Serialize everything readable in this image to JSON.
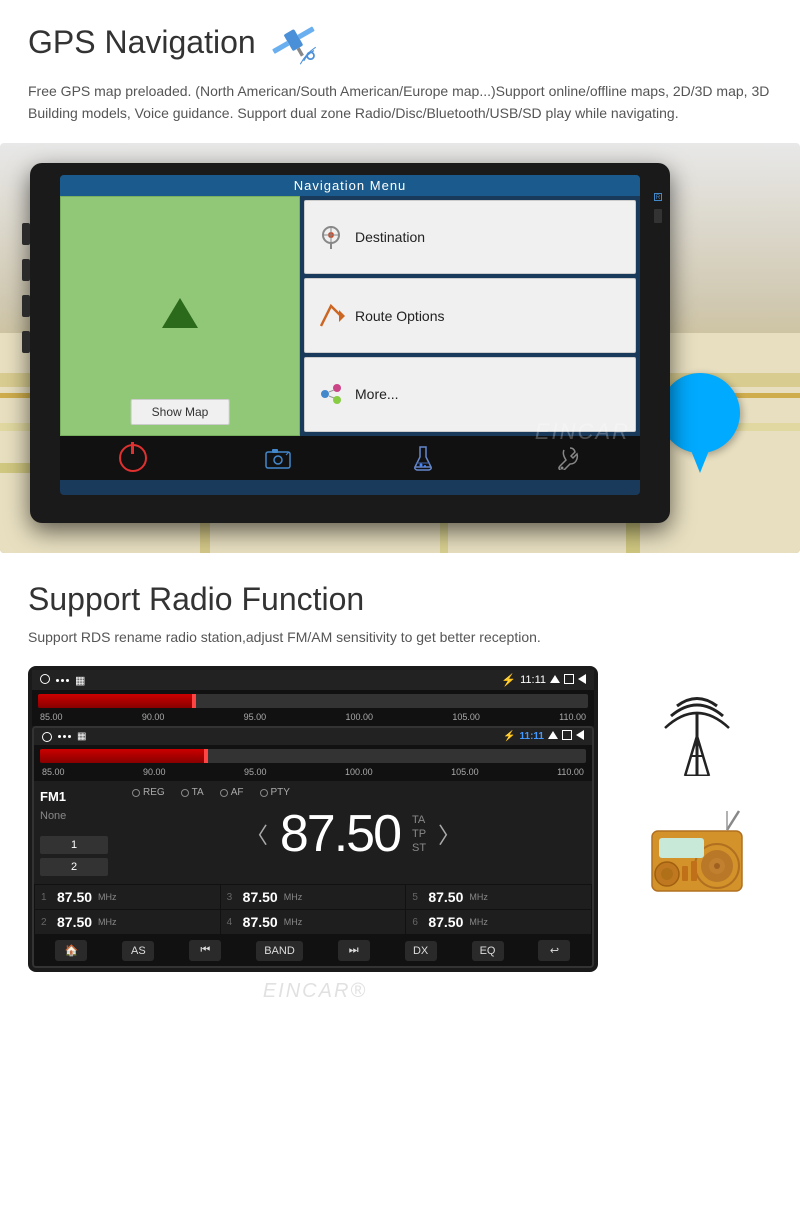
{
  "gps": {
    "title": "GPS Navigation",
    "description": "Free GPS map preloaded. (North American/South American/Europe map...)Support\nonline/offline maps, 2D/3D map, 3D Building models, Voice guidance.\nSupport dual zone Radio/Disc/Bluetooth/USB/SD play while navigating."
  },
  "nav_menu": {
    "title": "Navigation Menu",
    "show_map": "Show Map",
    "destination": "Destination",
    "route_options": "Route Options",
    "more": "More...",
    "eincar": "EINCAR"
  },
  "radio": {
    "title": "Support Radio Function",
    "description": "Support RDS rename radio station,adjust FM/AM sensitivity to get better reception.",
    "fm_label": "FM1",
    "none_label": "None",
    "frequency": "87.50",
    "ta": "TA",
    "tp": "TP",
    "st": "ST",
    "time": "11:11",
    "modes": [
      "REG",
      "TA",
      "AF",
      "PTY"
    ],
    "scale": [
      "85.00",
      "90.00",
      "95.00",
      "100.00",
      "105.00",
      "110.00"
    ],
    "presets": [
      {
        "num": "1",
        "freq": "87.50",
        "mhz": "MHz"
      },
      {
        "num": "3",
        "freq": "87.50",
        "mhz": "MHz"
      },
      {
        "num": "5",
        "freq": "87.50",
        "mhz": "MHz"
      },
      {
        "num": "2",
        "freq": "87.50",
        "mhz": "MHz"
      },
      {
        "num": "4",
        "freq": "87.50",
        "mhz": "MHz"
      },
      {
        "num": "6",
        "freq": "87.50",
        "mhz": "MHz"
      }
    ],
    "nav_btns": [
      "🏠",
      "AS",
      "⏮",
      "BAND",
      "⏭",
      "DX",
      "EQ",
      "↩"
    ],
    "preset_labels": [
      "1",
      "2"
    ]
  }
}
